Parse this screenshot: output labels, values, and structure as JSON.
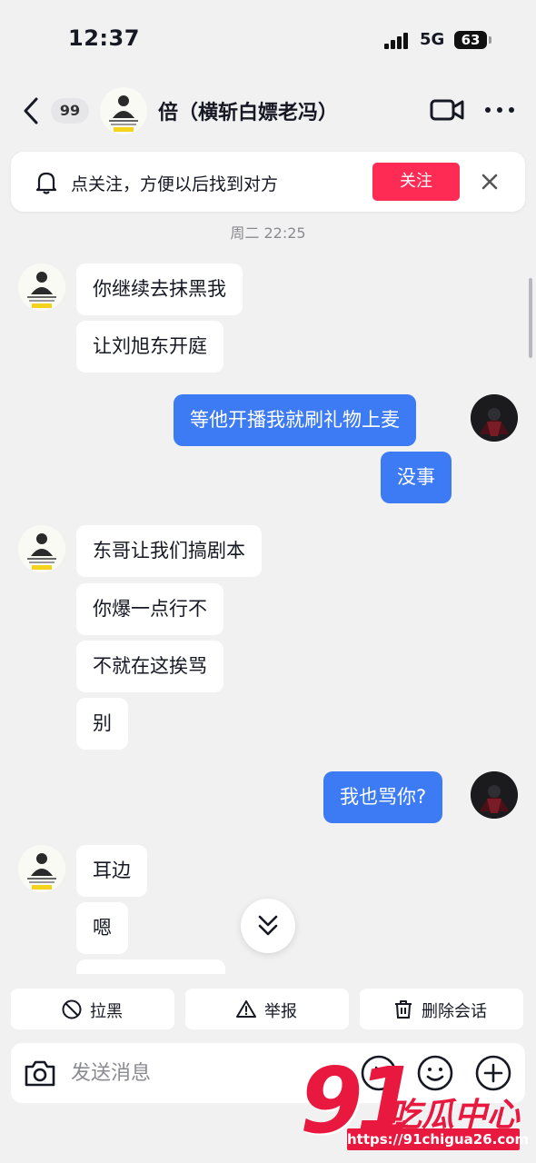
{
  "status_bar": {
    "time": "12:37",
    "network": "5G",
    "battery": "63"
  },
  "header": {
    "back_icon": "chevron-left-icon",
    "unread_count": "99",
    "title": "倍（横斩白嫖老冯）",
    "video_icon": "video-camera-icon",
    "more_icon": "more-dots-icon"
  },
  "follow_banner": {
    "icon": "bell-icon",
    "text": "点关注，方便以后找到对方",
    "follow_label": "关注",
    "close_icon": "close-icon"
  },
  "chat": {
    "timestamp": "周二 22:25",
    "messages": [
      {
        "from": "them",
        "text": "你继续去抹黑我"
      },
      {
        "from": "them",
        "text": "让刘旭东开庭"
      },
      {
        "from": "me",
        "text": "等他开播我就刷礼物上麦"
      },
      {
        "from": "me",
        "text": "没事"
      },
      {
        "from": "them",
        "text": "东哥让我们搞剧本"
      },
      {
        "from": "them",
        "text": "你爆一点行不"
      },
      {
        "from": "them",
        "text": "不就在这挨骂"
      },
      {
        "from": "them",
        "text": "别"
      },
      {
        "from": "me",
        "text": "我也骂你?"
      },
      {
        "from": "them",
        "text": "耳边"
      },
      {
        "from": "them",
        "text": "嗯"
      }
    ]
  },
  "actions": {
    "block_label": "拉黑",
    "report_label": "举报",
    "delete_label": "删除会话"
  },
  "composer": {
    "placeholder": "发送消息",
    "camera_icon": "camera-icon",
    "emoji_icon": "smiley-icon",
    "plus_icon": "plus-icon"
  },
  "watermark": {
    "number": "91",
    "brand": "吃瓜中心",
    "url": "https://91chigua26.com"
  },
  "colors": {
    "accent_red": "#fe2c55",
    "outgoing_bubble": "#3d7bf5",
    "background": "#f1f1f2"
  }
}
